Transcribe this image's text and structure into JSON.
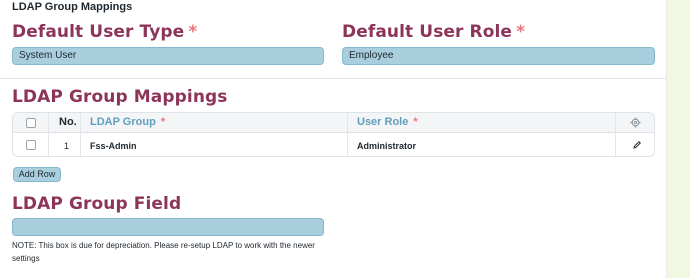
{
  "section": {
    "title": "LDAP Group Mappings"
  },
  "fields": {
    "default_user_type": {
      "label": "Default User Type",
      "required_mark": "*",
      "value": "System User"
    },
    "default_user_role": {
      "label": "Default User Role",
      "required_mark": "*",
      "value": "Employee"
    }
  },
  "mappings": {
    "heading": "LDAP Group Mappings",
    "columns": {
      "no": "No.",
      "ldap_group": "LDAP Group",
      "ldap_group_req": "*",
      "user_role": "User Role",
      "user_role_req": "*"
    },
    "rows": [
      {
        "no": "1",
        "ldap_group": "Fss-Admin",
        "user_role": "Administrator"
      }
    ],
    "add_row_label": "Add Row"
  },
  "group_field": {
    "label": "LDAP Group Field",
    "value": "",
    "note": "NOTE: This box is due for depreciation. Please re-setup LDAP to work with the newer settings"
  },
  "icons": [
    "gear-icon",
    "edit-icon",
    "checkbox-icon"
  ],
  "colors": {
    "heading": "#8d3559",
    "required": "#e8747c",
    "control_bg": "#a9cfdf",
    "column_header": "#5e9fbd",
    "rail": "#f1f8e1"
  }
}
